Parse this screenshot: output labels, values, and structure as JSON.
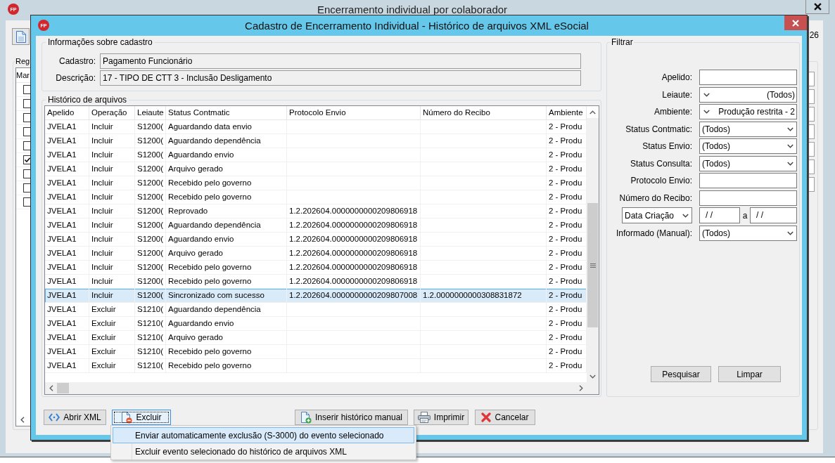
{
  "background_window": {
    "logo": "FP",
    "title": "Encerramento individual por colaborador",
    "side_text": "26",
    "group_title": "Reg",
    "list": {
      "column_header": "Mar",
      "rows": [
        {
          "checked": false
        },
        {
          "checked": false
        },
        {
          "checked": false
        },
        {
          "checked": false
        },
        {
          "checked": false
        },
        {
          "checked": true
        },
        {
          "checked": false
        },
        {
          "checked": false
        },
        {
          "checked": false
        }
      ]
    }
  },
  "dialog": {
    "logo": "FP",
    "title": "Cadastro de Encerramento Individual - Histórico de arquivos XML eSocial",
    "info": {
      "title": "Informações sobre cadastro",
      "fields": [
        {
          "label": "Cadastro:",
          "value": "Pagamento Funcionário"
        },
        {
          "label": "Descrição:",
          "value": "17 - TIPO DE CTT 3 - Inclusão Desligamento"
        }
      ]
    },
    "history": {
      "title": "Histórico de arquivos",
      "columns": [
        "Apelido",
        "Operação",
        "Leiaute",
        "Status Contmatic",
        "Protocolo Envio",
        "Número do Recibo",
        "Ambiente"
      ],
      "rows": [
        {
          "apelido": "JVELA1",
          "operacao": "Incluir",
          "leiaute": "S1200(",
          "status_contmatic": "Aguardando data envio",
          "ambiente": "2 - Produ",
          "selected": false
        },
        {
          "apelido": "JVELA1",
          "operacao": "Incluir",
          "leiaute": "S1200(",
          "status_contmatic": "Aguardando dependência",
          "ambiente": "2 - Produ",
          "selected": false
        },
        {
          "apelido": "JVELA1",
          "operacao": "Incluir",
          "leiaute": "S1200(",
          "status_contmatic": "Aguardando envio",
          "ambiente": "2 - Produ",
          "selected": false
        },
        {
          "apelido": "JVELA1",
          "operacao": "Incluir",
          "leiaute": "S1200(",
          "status_contmatic": "Arquivo gerado",
          "ambiente": "2 - Produ",
          "selected": false
        },
        {
          "apelido": "JVELA1",
          "operacao": "Incluir",
          "leiaute": "S1200(",
          "status_contmatic": "Recebido pelo governo",
          "ambiente": "2 - Produ",
          "selected": false
        },
        {
          "apelido": "JVELA1",
          "operacao": "Incluir",
          "leiaute": "S1200(",
          "status_contmatic": "Recebido pelo governo",
          "ambiente": "2 - Produ",
          "selected": false
        },
        {
          "apelido": "JVELA1",
          "operacao": "Incluir",
          "leiaute": "S1200(",
          "status_contmatic": "Reprovado",
          "protocolo_envio": "1.2.202604.0000000000209806918",
          "ambiente": "2 - Produ",
          "selected": false
        },
        {
          "apelido": "JVELA1",
          "operacao": "Incluir",
          "leiaute": "S1200(",
          "status_contmatic": "Aguardando dependência",
          "protocolo_envio": "1.2.202604.0000000000209806918",
          "ambiente": "2 - Produ",
          "selected": false
        },
        {
          "apelido": "JVELA1",
          "operacao": "Incluir",
          "leiaute": "S1200(",
          "status_contmatic": "Aguardando envio",
          "protocolo_envio": "1.2.202604.0000000000209806918",
          "ambiente": "2 - Produ",
          "selected": false
        },
        {
          "apelido": "JVELA1",
          "operacao": "Incluir",
          "leiaute": "S1200(",
          "status_contmatic": "Arquivo gerado",
          "protocolo_envio": "1.2.202604.0000000000209806918",
          "ambiente": "2 - Produ",
          "selected": false
        },
        {
          "apelido": "JVELA1",
          "operacao": "Incluir",
          "leiaute": "S1200(",
          "status_contmatic": "Recebido pelo governo",
          "protocolo_envio": "1.2.202604.0000000000209806918",
          "ambiente": "2 - Produ",
          "selected": false
        },
        {
          "apelido": "JVELA1",
          "operacao": "Incluir",
          "leiaute": "S1200(",
          "status_contmatic": "Recebido pelo governo",
          "protocolo_envio": "1.2.202604.0000000000209806918",
          "ambiente": "2 - Produ",
          "selected": false
        },
        {
          "apelido": "JVELA1",
          "operacao": "Incluir",
          "leiaute": "S1200(",
          "status_contmatic": "Sincronizado com sucesso",
          "protocolo_envio": "1.2.202604.0000000000209807008",
          "numero_recibo": "1.2.0000000000308831872",
          "ambiente": "2 - Produ",
          "selected": true
        },
        {
          "apelido": "JVELA1",
          "operacao": "Excluir",
          "leiaute": "S1210(",
          "status_contmatic": "Aguardando dependência",
          "ambiente": "2 - Produ",
          "selected": false
        },
        {
          "apelido": "JVELA1",
          "operacao": "Excluir",
          "leiaute": "S1210(",
          "status_contmatic": "Aguardando envio",
          "ambiente": "2 - Produ",
          "selected": false
        },
        {
          "apelido": "JVELA1",
          "operacao": "Excluir",
          "leiaute": "S1210(",
          "status_contmatic": "Arquivo gerado",
          "ambiente": "2 - Produ",
          "selected": false
        },
        {
          "apelido": "JVELA1",
          "operacao": "Excluir",
          "leiaute": "S1210(",
          "status_contmatic": "Recebido pelo governo",
          "ambiente": "2 - Produ",
          "selected": false
        },
        {
          "apelido": "JVELA1",
          "operacao": "Excluir",
          "leiaute": "S1210(",
          "status_contmatic": "Recebido pelo governo",
          "ambiente": "2 - Produ",
          "selected": false
        }
      ]
    },
    "filter": {
      "title": "Filtrar",
      "fields": [
        {
          "kind": "text",
          "label": "Apelido:"
        },
        {
          "kind": "checklist",
          "label": "Leiaute:",
          "value": "(Todos)"
        },
        {
          "kind": "checklist",
          "label": "Ambiente:",
          "value": "Produção restrita - 2"
        },
        {
          "kind": "combo",
          "label": "Status Contmatic:",
          "value": "(Todos)"
        },
        {
          "kind": "combo",
          "label": "Status Envio:",
          "value": "(Todos)"
        },
        {
          "kind": "combo",
          "label": "Status Consulta:",
          "value": "(Todos)"
        },
        {
          "kind": "text",
          "label": "Protocolo Envio:"
        },
        {
          "kind": "text",
          "label": "Número do Recibo:"
        },
        {
          "kind": "date_range",
          "selector": "Data Criação",
          "from": "/ /",
          "separator": "a",
          "to": "/ /"
        },
        {
          "kind": "combo",
          "label": "Informado (Manual):",
          "value": "(Todos)"
        }
      ],
      "buttons": [
        {
          "label": "Pesquisar"
        },
        {
          "label": "Limpar"
        }
      ]
    },
    "buttons": [
      {
        "label": "Abrir XML",
        "focused": false
      },
      {
        "label": "Excluir",
        "focused": true
      },
      {
        "label": "Inserir histórico manual",
        "focused": false
      },
      {
        "label": "Imprimir",
        "focused": false
      },
      {
        "label": "Cancelar",
        "focused": false
      }
    ],
    "menu": {
      "items": [
        {
          "label": "Enviar automaticamente exclusão (S-3000) do evento selecionado",
          "selected": true
        },
        {
          "label": "Excluir evento selecionado do histórico de arquivos XML",
          "selected": false
        }
      ]
    }
  }
}
